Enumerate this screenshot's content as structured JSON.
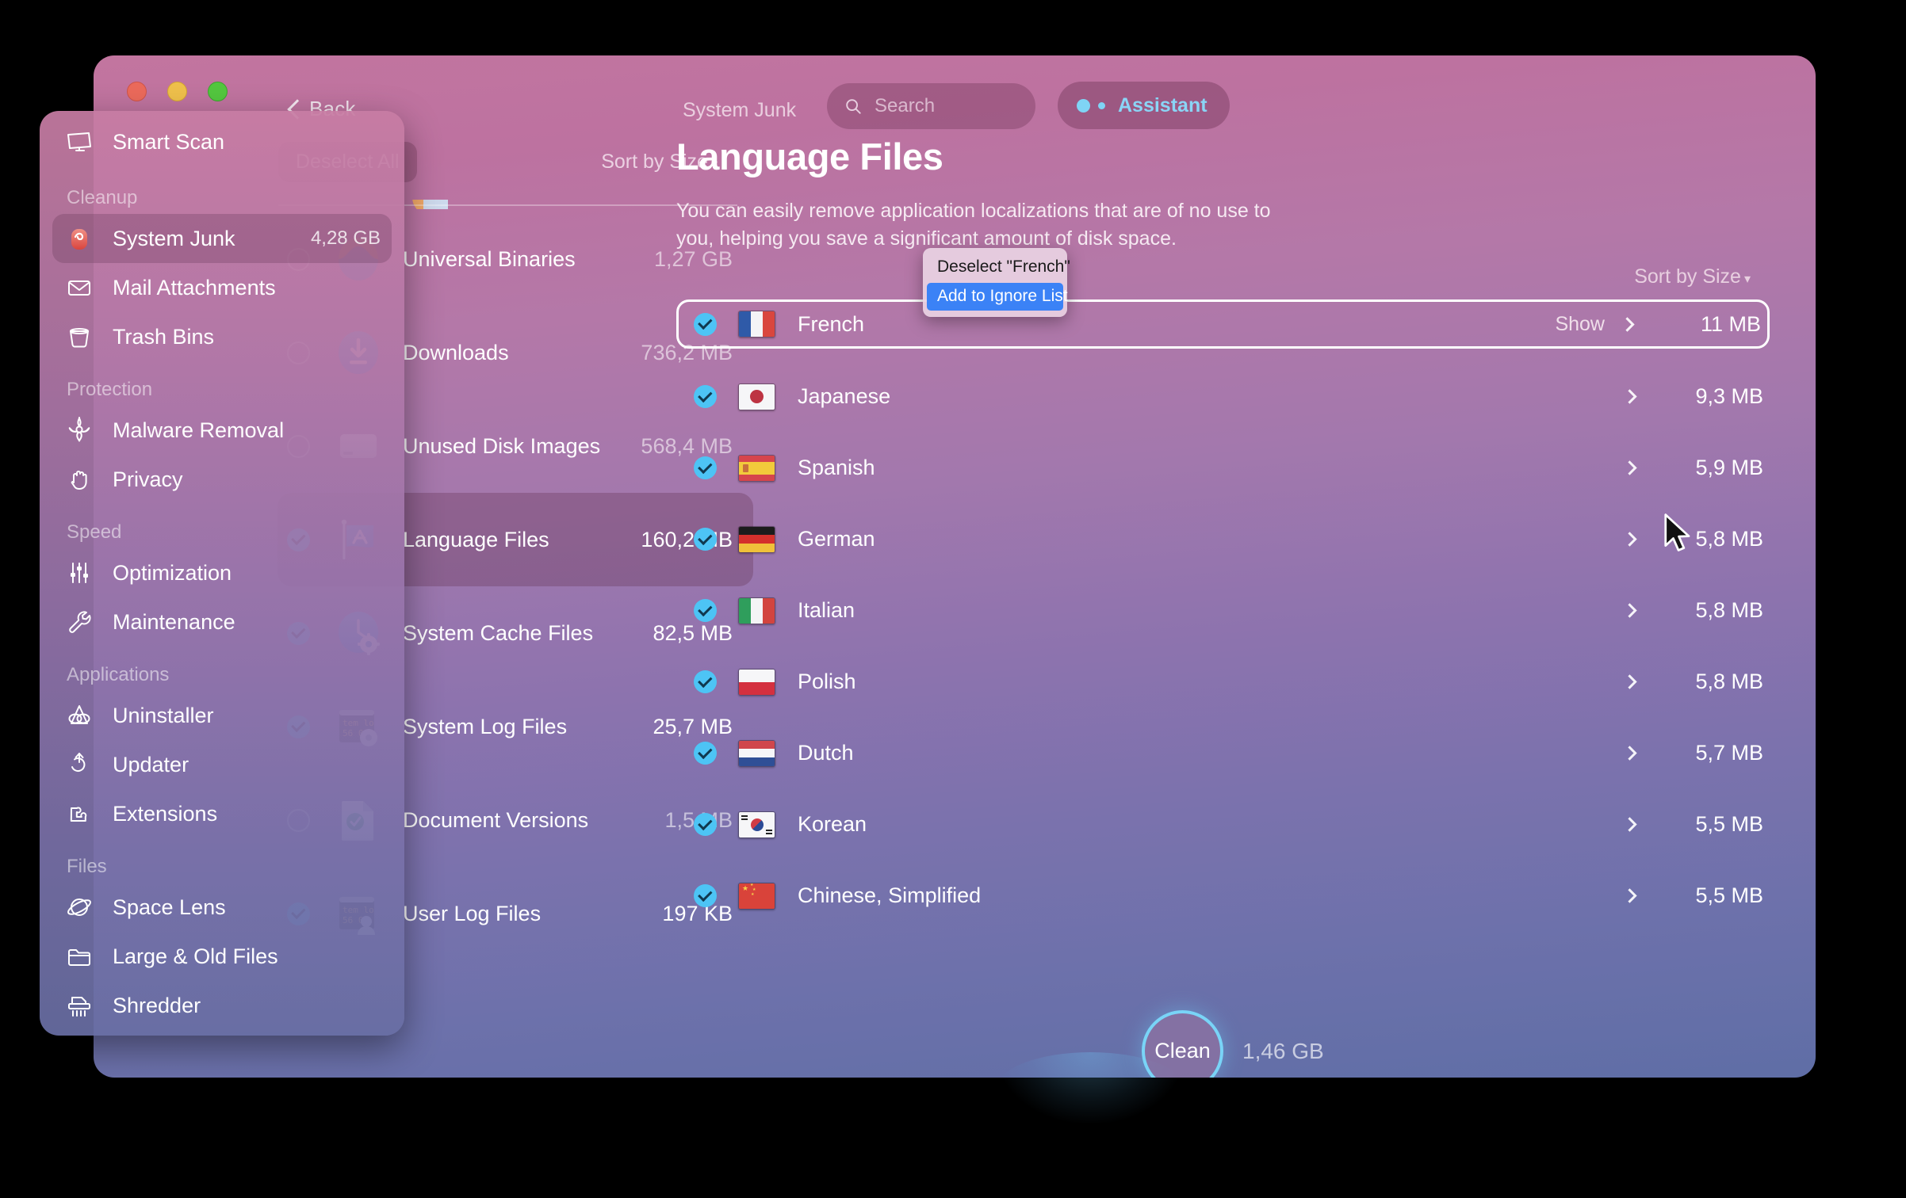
{
  "window": {
    "traffic_lights": [
      "close",
      "minimize",
      "zoom"
    ]
  },
  "toolbar": {
    "back_label": "Back",
    "breadcrumb": "System Junk",
    "search_placeholder": "Search",
    "assistant_label": "Assistant"
  },
  "sidebar": {
    "top_item": {
      "label": "Smart Scan",
      "icon": "smart-scan-icon"
    },
    "sections": [
      {
        "title": "Cleanup",
        "items": [
          {
            "label": "System Junk",
            "badge": "4,28 GB",
            "icon": "system-junk-icon",
            "active": true
          },
          {
            "label": "Mail Attachments",
            "badge": "",
            "icon": "mail-icon",
            "active": false
          },
          {
            "label": "Trash Bins",
            "badge": "",
            "icon": "trash-icon",
            "active": false
          }
        ]
      },
      {
        "title": "Protection",
        "items": [
          {
            "label": "Malware Removal",
            "badge": "",
            "icon": "biohazard-icon",
            "active": false
          },
          {
            "label": "Privacy",
            "badge": "",
            "icon": "hand-icon",
            "active": false
          }
        ]
      },
      {
        "title": "Speed",
        "items": [
          {
            "label": "Optimization",
            "badge": "",
            "icon": "sliders-icon",
            "active": false
          },
          {
            "label": "Maintenance",
            "badge": "",
            "icon": "wrench-icon",
            "active": false
          }
        ]
      },
      {
        "title": "Applications",
        "items": [
          {
            "label": "Uninstaller",
            "badge": "",
            "icon": "uninstaller-icon",
            "active": false
          },
          {
            "label": "Updater",
            "badge": "",
            "icon": "updater-icon",
            "active": false
          },
          {
            "label": "Extensions",
            "badge": "",
            "icon": "puzzle-icon",
            "active": false
          }
        ]
      },
      {
        "title": "Files",
        "items": [
          {
            "label": "Space Lens",
            "badge": "",
            "icon": "space-lens-icon",
            "active": false
          },
          {
            "label": "Large & Old Files",
            "badge": "",
            "icon": "folder-icon",
            "active": false
          },
          {
            "label": "Shredder",
            "badge": "",
            "icon": "shredder-icon",
            "active": false
          }
        ]
      }
    ]
  },
  "junk_list": {
    "deselect_all_label": "Deselect All",
    "sort_label": "Sort by Size",
    "sort_caret": "▾",
    "items": [
      {
        "label": "Universal Binaries",
        "size": "1,27 GB",
        "checked": false,
        "icon": "universal-binaries-icon",
        "selected": false
      },
      {
        "label": "Downloads",
        "size": "736,2 MB",
        "checked": false,
        "icon": "downloads-icon",
        "selected": false
      },
      {
        "label": "Unused Disk Images",
        "size": "568,4 MB",
        "checked": false,
        "icon": "disk-image-icon",
        "selected": false
      },
      {
        "label": "Language Files",
        "size": "160,2 MB",
        "checked": true,
        "icon": "language-files-icon",
        "selected": true
      },
      {
        "label": "System Cache Files",
        "size": "82,5 MB",
        "checked": true,
        "icon": "system-cache-icon",
        "selected": false
      },
      {
        "label": "System Log Files",
        "size": "25,7 MB",
        "checked": true,
        "icon": "system-log-icon",
        "selected": false
      },
      {
        "label": "Document Versions",
        "size": "1,5 MB",
        "checked": false,
        "icon": "document-versions-icon",
        "selected": false
      },
      {
        "label": "User Log Files",
        "size": "197 KB",
        "checked": true,
        "icon": "user-log-icon",
        "selected": false
      }
    ]
  },
  "detail": {
    "title": "Language Files",
    "description": "You can easily remove application localizations that are of no use to you, helping you save a significant amount of disk space.",
    "sort_label": "Sort by Size",
    "sort_caret": "▾",
    "show_label": "Show",
    "languages": [
      {
        "name": "French",
        "size": "11 MB",
        "checked": true,
        "flag": "fr",
        "focused": true,
        "show": "Show"
      },
      {
        "name": "Japanese",
        "size": "9,3 MB",
        "checked": true,
        "flag": "jp",
        "focused": false,
        "show": ""
      },
      {
        "name": "Spanish",
        "size": "5,9 MB",
        "checked": true,
        "flag": "es",
        "focused": false,
        "show": ""
      },
      {
        "name": "German",
        "size": "5,8 MB",
        "checked": true,
        "flag": "de",
        "focused": false,
        "show": ""
      },
      {
        "name": "Italian",
        "size": "5,8 MB",
        "checked": true,
        "flag": "it",
        "focused": false,
        "show": ""
      },
      {
        "name": "Polish",
        "size": "5,8 MB",
        "checked": true,
        "flag": "pl",
        "focused": false,
        "show": ""
      },
      {
        "name": "Dutch",
        "size": "5,7 MB",
        "checked": true,
        "flag": "nl",
        "focused": false,
        "show": ""
      },
      {
        "name": "Korean",
        "size": "5,5 MB",
        "checked": true,
        "flag": "kr",
        "focused": false,
        "show": ""
      },
      {
        "name": "Chinese, Simplified",
        "size": "5,5 MB",
        "checked": true,
        "flag": "cn",
        "focused": false,
        "show": ""
      }
    ]
  },
  "context_menu": {
    "items": [
      {
        "label": "Deselect \"French\"",
        "highlighted": false
      },
      {
        "label": "Add to Ignore List",
        "highlighted": true
      }
    ]
  },
  "footer": {
    "clean_label": "Clean",
    "clean_size": "1,46 GB"
  },
  "colors": {
    "accent_blue": "#4dc4f5",
    "menu_highlight": "#3b82f6",
    "window_top": "#c2759f",
    "window_bottom": "#5f6ea6"
  }
}
